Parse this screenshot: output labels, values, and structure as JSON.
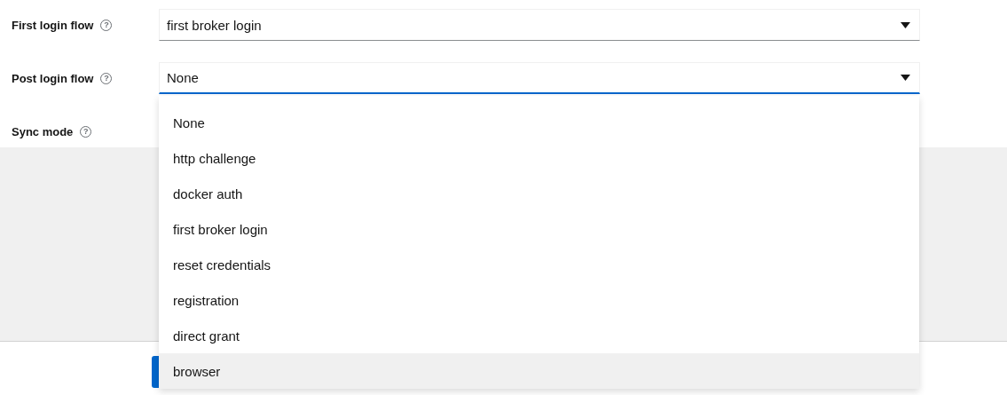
{
  "fields": [
    {
      "label": "First login flow",
      "help": "?",
      "value": "first broker login",
      "kind": "select",
      "focused": false
    },
    {
      "label": "Post login flow",
      "help": "?",
      "value": "None",
      "kind": "select",
      "focused": true
    },
    {
      "label": "Sync mode",
      "help": "?",
      "kind": "label"
    }
  ],
  "menu": {
    "options": [
      {
        "label": "None",
        "highlighted": false
      },
      {
        "label": "http challenge",
        "highlighted": false
      },
      {
        "label": "docker auth",
        "highlighted": false
      },
      {
        "label": "first broker login",
        "highlighted": false
      },
      {
        "label": "reset credentials",
        "highlighted": false
      },
      {
        "label": "registration",
        "highlighted": false
      },
      {
        "label": "direct grant",
        "highlighted": false
      },
      {
        "label": "browser",
        "highlighted": true
      }
    ]
  }
}
